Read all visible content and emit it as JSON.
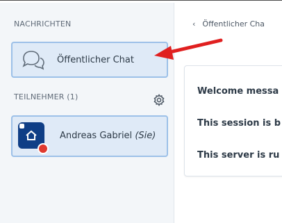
{
  "sidebar": {
    "messages_title": "NACHRICHTEN",
    "chat_item": {
      "label": "Öffentlicher Chat",
      "icon": "chat-bubbles-icon"
    },
    "participants_title": "TEILNEHMER (1)",
    "settings_icon": "gear-icon",
    "user": {
      "name": "Andreas Gabriel",
      "you_tag": "(Sie)",
      "avatar_icon": "home-icon"
    }
  },
  "panel": {
    "back_label": "Öffentlicher Cha",
    "messages": [
      "Welcome messa",
      "This session is b",
      "This server is ru"
    ]
  },
  "colors": {
    "sidebar_bg": "#f3f6f9",
    "selected_bg": "#dfeaf7",
    "selected_border": "#9cc0e8",
    "avatar_bg": "#0f3e86",
    "status_red": "#e03a2f",
    "annotation_arrow": "#e02020"
  }
}
